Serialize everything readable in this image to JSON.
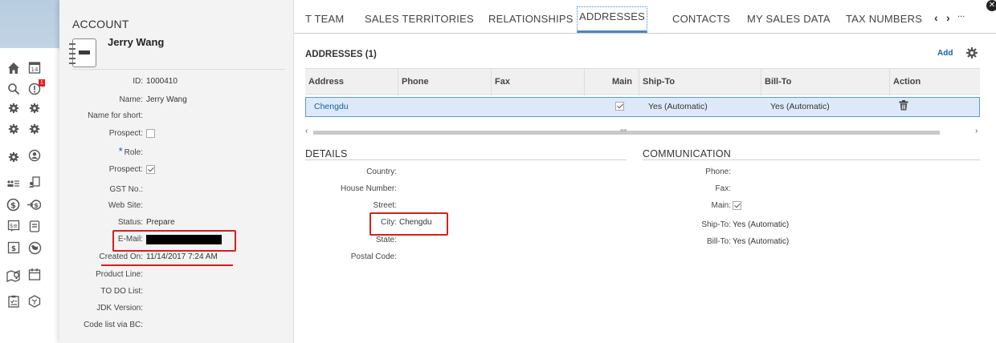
{
  "account": {
    "title": "ACCOUNT",
    "name": "Jerry Wang",
    "fields": [
      {
        "label": "ID:",
        "value": "1000410"
      },
      {
        "label": "Name:",
        "value": "Jerry Wang"
      },
      {
        "label": "Name for short:",
        "value": ""
      },
      {
        "label": "Prospect:",
        "value": ""
      },
      {
        "label": "Role:",
        "value": ""
      },
      {
        "label": "Prospect:",
        "value": ""
      },
      {
        "label": "GST No.:",
        "value": ""
      },
      {
        "label": "Web Site:",
        "value": ""
      },
      {
        "label": "Status:",
        "value": "Prepare"
      },
      {
        "label": "E-Mail:",
        "value": ""
      },
      {
        "label": "Created On:",
        "value": "11/14/2017 7:24 AM"
      },
      {
        "label": "Product Line:",
        "value": ""
      },
      {
        "label": "TO DO List:",
        "value": ""
      },
      {
        "label": "JDK Version:",
        "value": ""
      },
      {
        "label": "Code list via BC:",
        "value": ""
      }
    ]
  },
  "tabs": [
    "T TEAM",
    "SALES TERRITORIES",
    "RELATIONSHIPS",
    "ADDRESSES",
    "CONTACTS",
    "MY SALES DATA",
    "TAX NUMBERS"
  ],
  "tab_nav": {
    "prev": "‹",
    "next": "›",
    "more": "..."
  },
  "addresses": {
    "title": "ADDRESSES (1)",
    "add_label": "Add",
    "columns": [
      "Address",
      "Phone",
      "Fax",
      "Main",
      "Ship-To",
      "Bill-To",
      "Action"
    ],
    "rows": [
      {
        "address": "Chengdu",
        "phone": "",
        "fax": "",
        "main": true,
        "ship_to": "Yes (Automatic)",
        "bill_to": "Yes (Automatic)"
      }
    ]
  },
  "details": {
    "title": "DETAILS",
    "fields": [
      {
        "label": "Country:",
        "value": ""
      },
      {
        "label": "House Number:",
        "value": ""
      },
      {
        "label": "Street:",
        "value": ""
      },
      {
        "label": "City:",
        "value": "Chengdu"
      },
      {
        "label": "State:",
        "value": ""
      },
      {
        "label": "Postal Code:",
        "value": ""
      }
    ]
  },
  "communication": {
    "title": "COMMUNICATION",
    "fields": [
      {
        "label": "Phone:",
        "value": ""
      },
      {
        "label": "Fax:",
        "value": ""
      },
      {
        "label": "Main:",
        "value": ""
      },
      {
        "label": "Ship-To:",
        "value": "Yes (Automatic)"
      },
      {
        "label": "Bill-To:",
        "value": "Yes (Automatic)"
      }
    ]
  },
  "rail_icons": [
    "home-icon",
    "calendar-icon",
    "search-icon",
    "alert-icon",
    "settings-icon",
    "settings-icon",
    "settings-icon",
    "settings-icon",
    "settings-icon",
    "user-circle-icon",
    "list-icon",
    "document-edit-icon",
    "dollar-icon",
    "transfer-dollar-icon",
    "receipt-icon",
    "clipboard-icon",
    "invoice-icon",
    "globe-person-icon",
    "map-icon",
    "calendar-icon",
    "checklist-icon",
    "package-icon"
  ],
  "badge": "1",
  "colors": {
    "accent": "#4a86c8",
    "link": "#1a5fa8",
    "highlight": "#d42020",
    "selected_row": "#dde9f8"
  }
}
